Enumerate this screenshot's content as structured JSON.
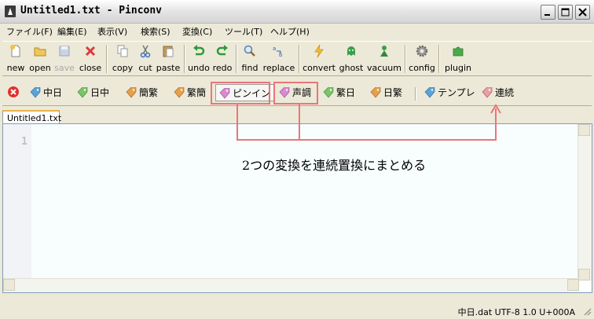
{
  "window": {
    "title": "Untitled1.txt - Pinconv"
  },
  "menu": [
    "ファイル(F)",
    "編集(E)",
    "表示(V)",
    "検索(S)",
    "変換(C)",
    "ツール(T)",
    "ヘルプ(H)"
  ],
  "toolbar": {
    "new": "new",
    "open": "open",
    "save": "save",
    "close": "close",
    "copy": "copy",
    "cut": "cut",
    "paste": "paste",
    "undo": "undo",
    "redo": "redo",
    "find": "find",
    "replace": "replace",
    "convert": "convert",
    "ghost": "ghost",
    "vacuum": "vacuum",
    "config": "config",
    "plugin": "plugin"
  },
  "converters": {
    "cn_jp": "中日",
    "jp_cn": "日中",
    "simp_trad": "簡繁",
    "trad_simp": "繁簡",
    "pinyin": "ピンイン",
    "tone": "声調",
    "trad_jp": "繁日",
    "jp_trad": "日繁",
    "template": "テンプレ",
    "serial": "連続"
  },
  "tab": {
    "label": "Untitled1.txt"
  },
  "editor": {
    "line_number": "1"
  },
  "annotation": "2つの変換を連続置換にまとめる",
  "status": {
    "text": "中日.dat   UTF-8   1.0   U+000A"
  },
  "colors": {
    "highlight": "#e9767a",
    "tag_blue": "#5aa3d8",
    "tag_green": "#7cc36a",
    "tag_pink": "#d88bd0",
    "tag_orange": "#e6a04a"
  }
}
